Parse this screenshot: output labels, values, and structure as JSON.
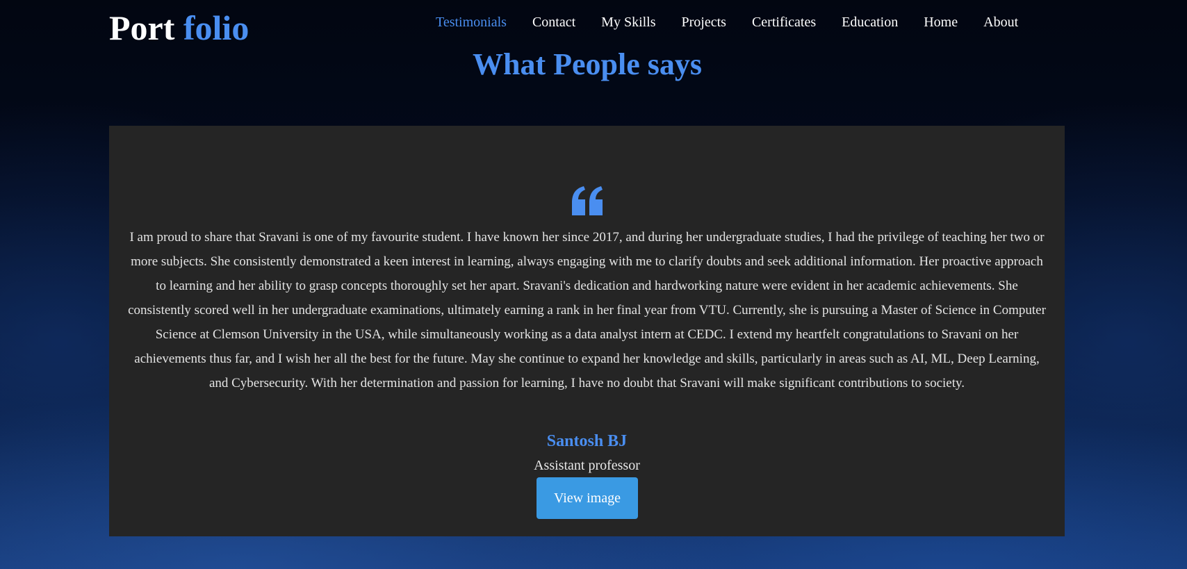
{
  "brand": {
    "part1": "Port",
    "part2": "folio"
  },
  "nav": {
    "items": [
      {
        "label": "Testimonials",
        "active": true
      },
      {
        "label": "Contact",
        "active": false
      },
      {
        "label": "My Skills",
        "active": false
      },
      {
        "label": "Projects",
        "active": false
      },
      {
        "label": "Certificates",
        "active": false
      },
      {
        "label": "Education",
        "active": false
      },
      {
        "label": "Home",
        "active": false
      },
      {
        "label": "About",
        "active": false
      }
    ]
  },
  "section": {
    "title": "What People says"
  },
  "testimonial": {
    "quote_icon": "quote-left-icon",
    "text": "I am proud to share that Sravani is one of my favourite student. I have known her since 2017, and during her undergraduate studies, I had the privilege of teaching her two or more subjects. She consistently demonstrated a keen interest in learning, always engaging with me to clarify doubts and seek additional information. Her proactive approach to learning and her ability to grasp concepts thoroughly set her apart. Sravani's dedication and hardworking nature were evident in her academic achievements. She consistently scored well in her undergraduate examinations, ultimately earning a rank in her final year from VTU. Currently, she is pursuing a Master of Science in Computer Science at Clemson University in the USA, while simultaneously working as a data analyst intern at CEDC. I extend my heartfelt congratulations to Sravani on her achievements thus far, and I wish her all the best for the future. May she continue to expand her knowledge and skills, particularly in areas such as AI, ML, Deep Learning, and Cybersecurity. With her determination and passion for learning, I have no doubt that Sravani will make significant contributions to society.",
    "author": "Santosh BJ",
    "role": "Assistant professor",
    "button_label": "View image"
  },
  "colors": {
    "accent": "#4a8ef0",
    "button": "#3a9ae3",
    "card_bg": "#252525"
  }
}
